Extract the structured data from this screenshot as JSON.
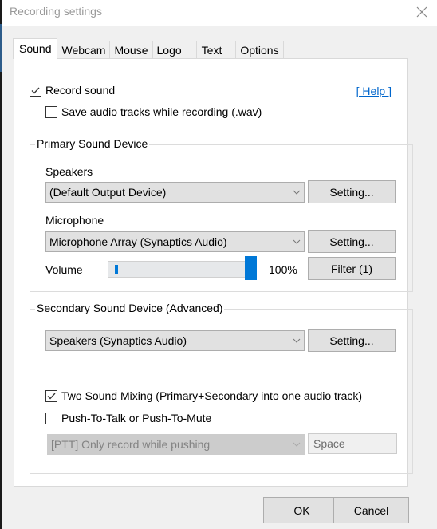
{
  "window": {
    "title": "Recording settings",
    "close_icon": "close-x"
  },
  "tabs": [
    {
      "label": "Sound",
      "active": true
    },
    {
      "label": "Webcam",
      "active": false
    },
    {
      "label": "Mouse",
      "active": false
    },
    {
      "label": "Logo",
      "active": false
    },
    {
      "label": "Text",
      "active": false
    },
    {
      "label": "Options",
      "active": false
    }
  ],
  "sound": {
    "record_sound": {
      "label": "Record sound",
      "checked": true
    },
    "save_wav": {
      "label": "Save audio tracks while recording (.wav)",
      "checked": false
    },
    "help_link": "[ Help ]",
    "primary": {
      "title": "Primary Sound Device",
      "speakers_label": "Speakers",
      "speakers_value": "(Default Output Device)",
      "speakers_setting": "Setting...",
      "microphone_label": "Microphone",
      "microphone_value": "Microphone Array (Synaptics Audio)",
      "microphone_setting": "Setting...",
      "volume_label": "Volume",
      "volume_value": 100,
      "volume_text": "100%",
      "filter_button": "Filter (1)"
    },
    "secondary": {
      "title": "Secondary Sound Device (Advanced)",
      "device_value": "Speakers (Synaptics Audio)",
      "device_setting": "Setting...",
      "two_sound_mixing": {
        "label": "Two Sound Mixing (Primary+Secondary into one audio track)",
        "checked": true
      },
      "push_to_talk": {
        "label": "Push-To-Talk or Push-To-Mute",
        "checked": false
      },
      "ptt_mode_value": "[PTT] Only record while pushing",
      "ptt_key": "Space"
    }
  },
  "footer": {
    "ok": "OK",
    "cancel": "Cancel"
  },
  "colors": {
    "accent": "#0078d7",
    "link": "#0066cc"
  }
}
